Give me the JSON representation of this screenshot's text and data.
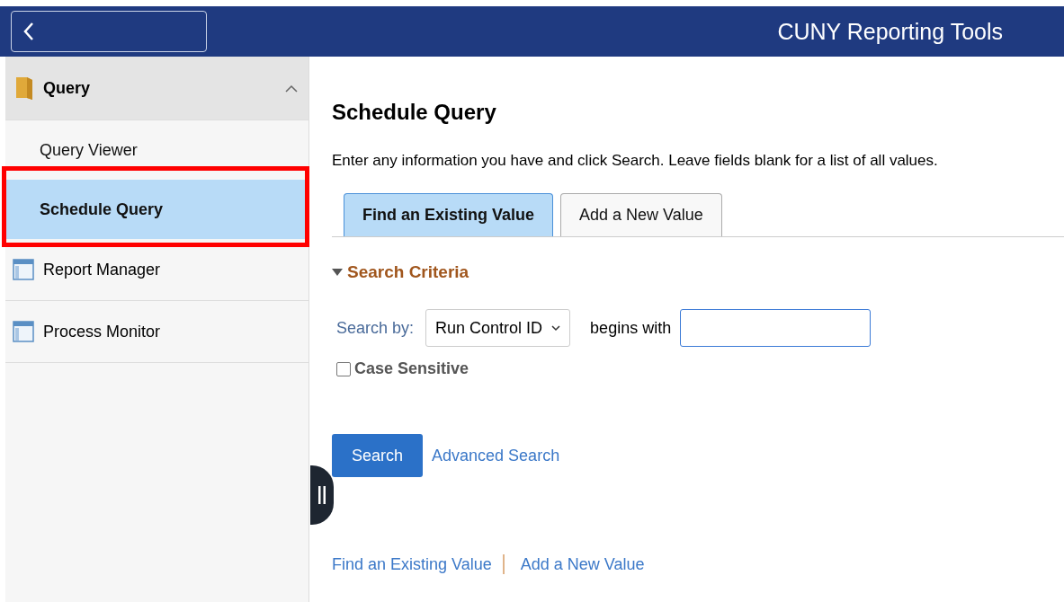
{
  "header": {
    "title": "CUNY Reporting Tools"
  },
  "sidebar": {
    "groups": [
      {
        "label": "Query",
        "kind": "folder",
        "expanded": true,
        "children": [
          {
            "label": "Query Viewer",
            "selected": false,
            "highlighted": false
          },
          {
            "label": "Schedule Query",
            "selected": true,
            "highlighted": true
          }
        ]
      },
      {
        "label": "Report Manager",
        "kind": "page"
      },
      {
        "label": "Process Monitor",
        "kind": "page"
      }
    ]
  },
  "main": {
    "title": "Schedule Query",
    "instructions": "Enter any information you have and click Search. Leave fields blank for a list of all values.",
    "tabs": [
      {
        "label": "Find an Existing Value",
        "selected": true
      },
      {
        "label": "Add a New Value",
        "selected": false
      }
    ],
    "section": {
      "label": "Search Criteria",
      "expanded": true
    },
    "search_by": {
      "label": "Search by:",
      "value": "Run Control ID",
      "operator": "begins with"
    },
    "case_sensitive": {
      "label": "Case Sensitive",
      "checked": false
    },
    "buttons": [
      {
        "label": "Search",
        "kind": "primary"
      },
      {
        "label": "Advanced Search",
        "kind": "link"
      }
    ],
    "footer_links": [
      "Find an Existing Value",
      "Add a New Value"
    ]
  }
}
